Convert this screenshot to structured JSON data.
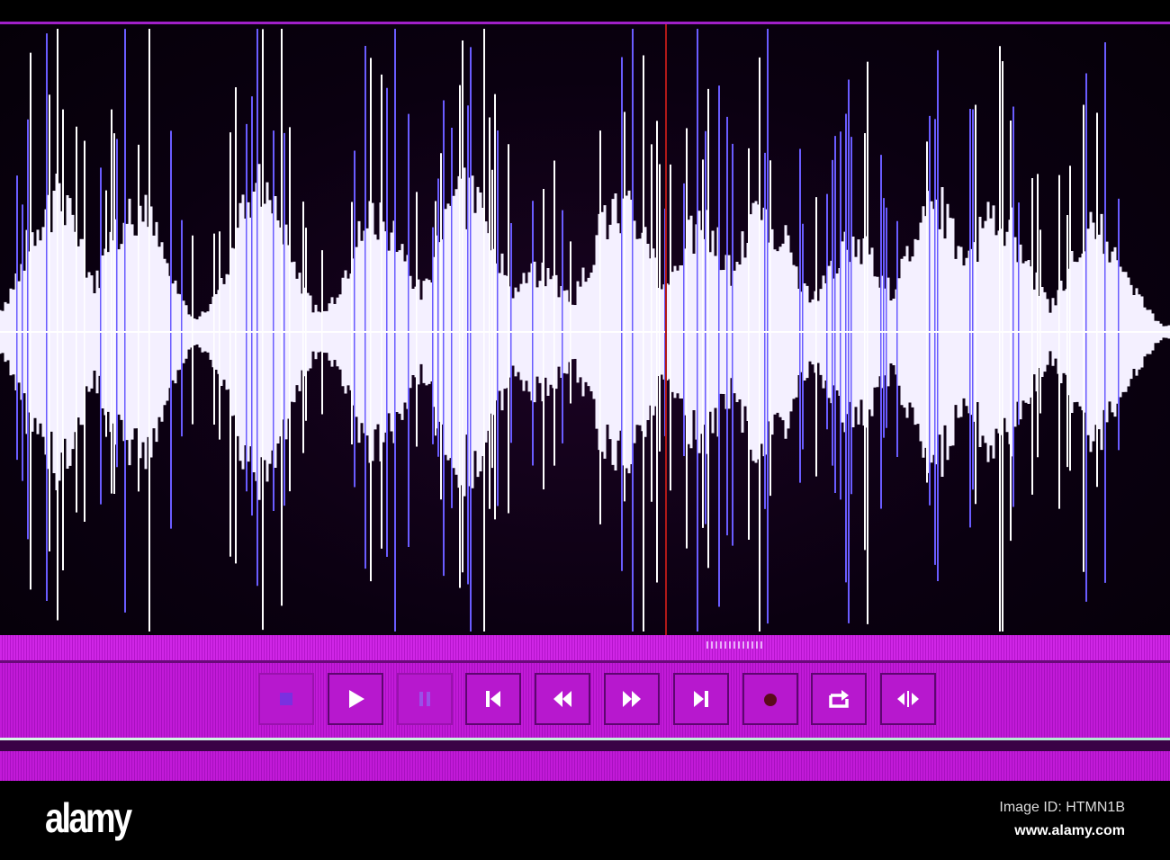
{
  "transport": {
    "buttons": [
      {
        "name": "stop",
        "icon": "stop-icon",
        "enabled": false
      },
      {
        "name": "play",
        "icon": "play-icon",
        "enabled": true
      },
      {
        "name": "pause",
        "icon": "pause-icon",
        "enabled": false
      },
      {
        "name": "go-to-start",
        "icon": "skip-start-icon",
        "enabled": true
      },
      {
        "name": "rewind",
        "icon": "rewind-icon",
        "enabled": true
      },
      {
        "name": "fast-forward",
        "icon": "fast-forward-icon",
        "enabled": true
      },
      {
        "name": "go-to-end",
        "icon": "skip-end-icon",
        "enabled": true
      },
      {
        "name": "record",
        "icon": "record-icon",
        "enabled": true
      },
      {
        "name": "loop",
        "icon": "loop-icon",
        "enabled": true
      },
      {
        "name": "skip-selection",
        "icon": "skip-selection-icon",
        "enabled": true
      }
    ]
  },
  "colors": {
    "accent": "#c21ad8",
    "waveform": "#ffffff",
    "waveform_edge": "#6a5cff",
    "playhead": "#b01818",
    "record": "#5a0a1a"
  },
  "footer": {
    "logo": "alamy",
    "image_id": "Image ID: HTMN1B",
    "site": "www.alamy.com"
  }
}
